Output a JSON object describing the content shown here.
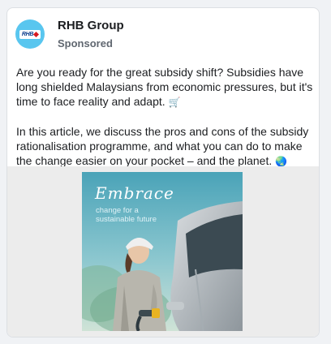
{
  "post": {
    "advertiser_name": "RHB Group",
    "sponsored_label": "Sponsored",
    "avatar_logo_text": "RHB",
    "paragraph_1": "Are you ready for the great subsidy shift? Subsidies have long shielded Malaysians from economic pressures, but it's time to face reality and adapt.",
    "paragraph_1_emoji": "🛒",
    "paragraph_2": "In this article, we discuss the pros and cons of the subsidy rationalisation programme, and what you can do to make the change easier on your pocket – and the planet.",
    "paragraph_2_emoji": "🌏"
  },
  "ad_creative": {
    "headline": "Embrace",
    "subline_1": "change for a",
    "subline_2": "sustainable future"
  },
  "colors": {
    "avatar_bg": "#59c6ef",
    "brand_blue": "#0b3c8c",
    "brand_red": "#d71920",
    "text_primary": "#1c1e21",
    "text_secondary": "#606770"
  },
  "icons": {
    "paragraph_1_emoji": "shopping-cart-icon",
    "paragraph_2_emoji": "globe-icon"
  }
}
